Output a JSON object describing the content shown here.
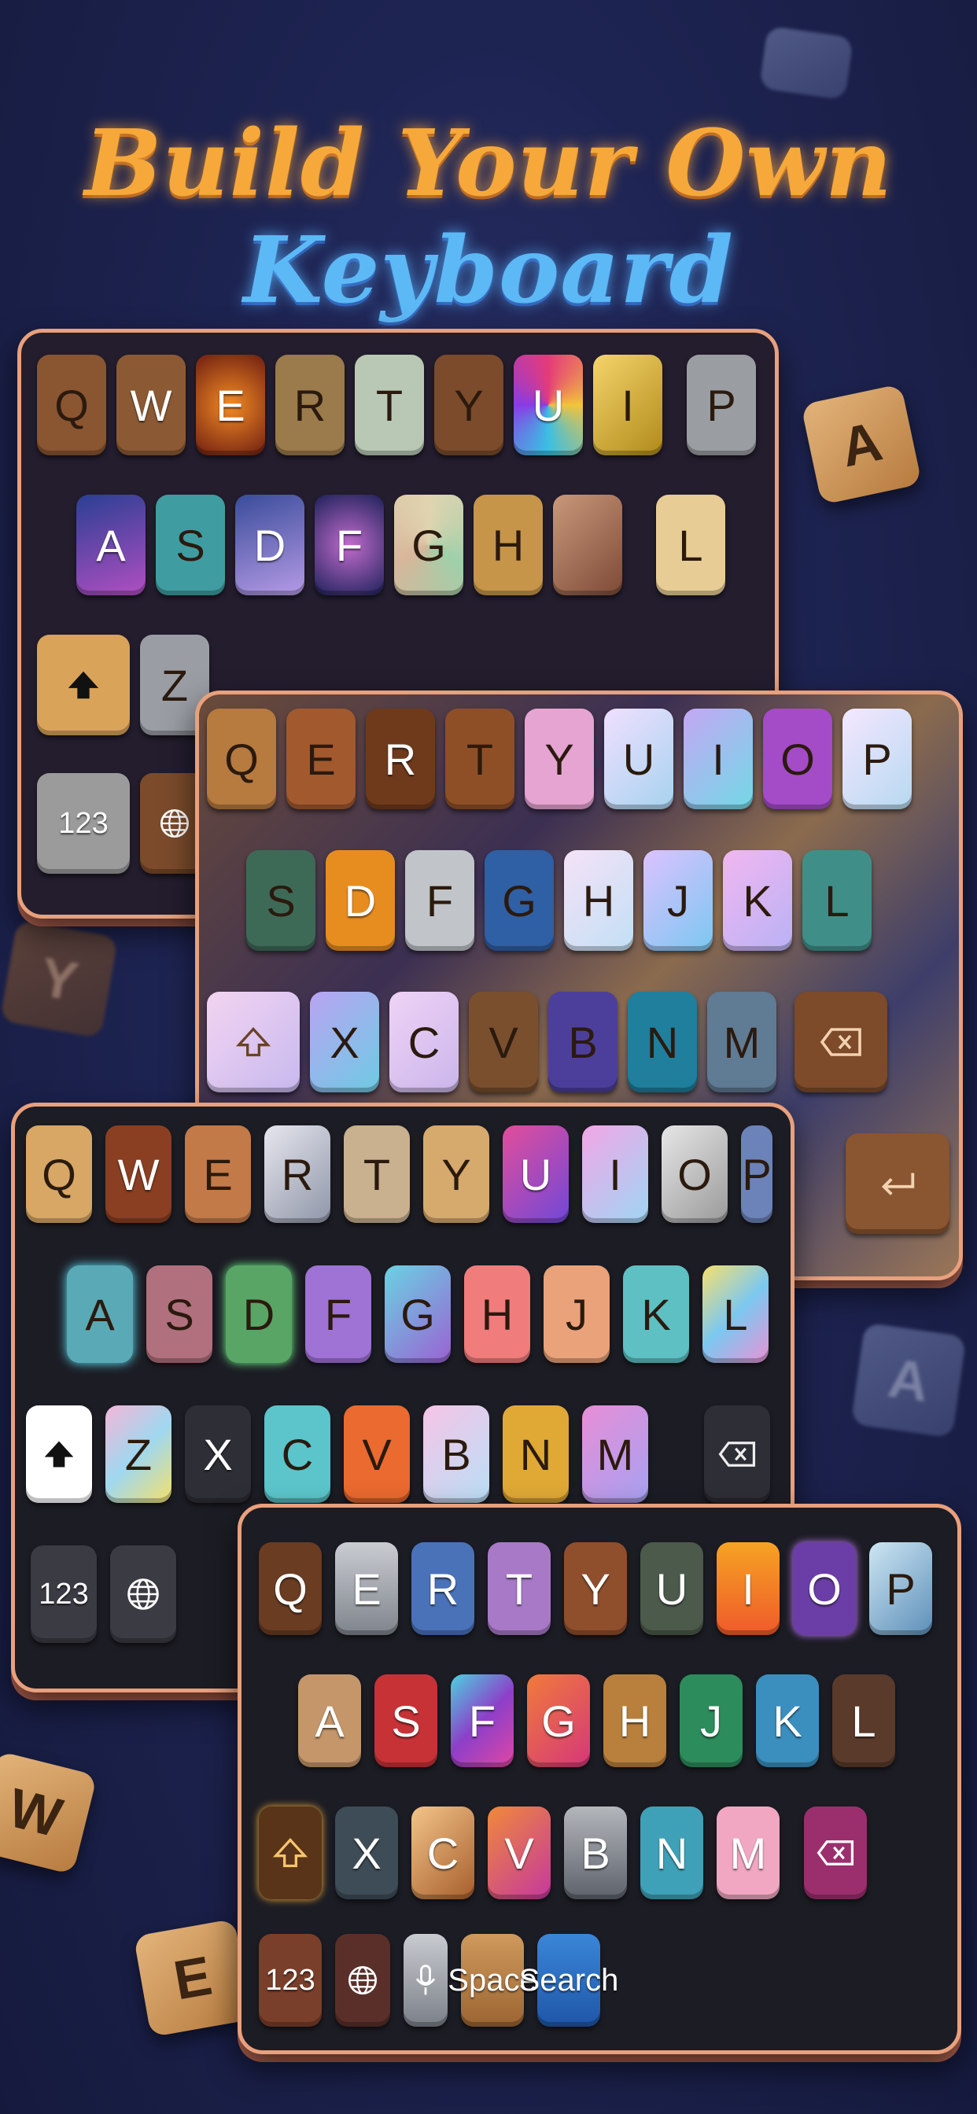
{
  "headline": {
    "part1": "Build Your Own",
    "part2": "Keyboard"
  },
  "floating_keys": [
    "A",
    "Y",
    "A",
    "W",
    "E"
  ],
  "keyboard1": {
    "row1": [
      "Q",
      "W",
      "E",
      "R",
      "T",
      "Y",
      "U",
      "I",
      "P"
    ],
    "row2": [
      "A",
      "S",
      "D",
      "F",
      "G",
      "H",
      "L"
    ],
    "row3": [
      "Z"
    ],
    "numbers_key": "123"
  },
  "keyboard2": {
    "row1": [
      "Q",
      "E",
      "R",
      "T",
      "Y",
      "U",
      "I",
      "O",
      "P"
    ],
    "row2": [
      "S",
      "D",
      "F",
      "G",
      "H",
      "J",
      "K",
      "L"
    ],
    "row3": [
      "X",
      "C",
      "V",
      "B",
      "N",
      "M"
    ]
  },
  "keyboard3": {
    "row1": [
      "Q",
      "W",
      "E",
      "R",
      "T",
      "Y",
      "U",
      "I",
      "O",
      "P"
    ],
    "row2": [
      "A",
      "S",
      "D",
      "F",
      "G",
      "H",
      "J",
      "K",
      "L"
    ],
    "row3": [
      "Z",
      "X",
      "C",
      "V",
      "B",
      "N",
      "M"
    ],
    "numbers_key": "123"
  },
  "keyboard4": {
    "row1": [
      "Q",
      "E",
      "R",
      "T",
      "Y",
      "U",
      "I",
      "O",
      "P"
    ],
    "row2": [
      "A",
      "S",
      "F",
      "G",
      "H",
      "J",
      "K",
      "L"
    ],
    "row3": [
      "X",
      "C",
      "V",
      "B",
      "N",
      "M"
    ],
    "numbers_key": "123",
    "space_label": "Space",
    "search_label": "Search"
  },
  "colors": {
    "headline_orange": "#f6a93a",
    "headline_blue": "#5cb9f5",
    "frame": "#e9a07c",
    "search_key": "#2a6fc4"
  }
}
